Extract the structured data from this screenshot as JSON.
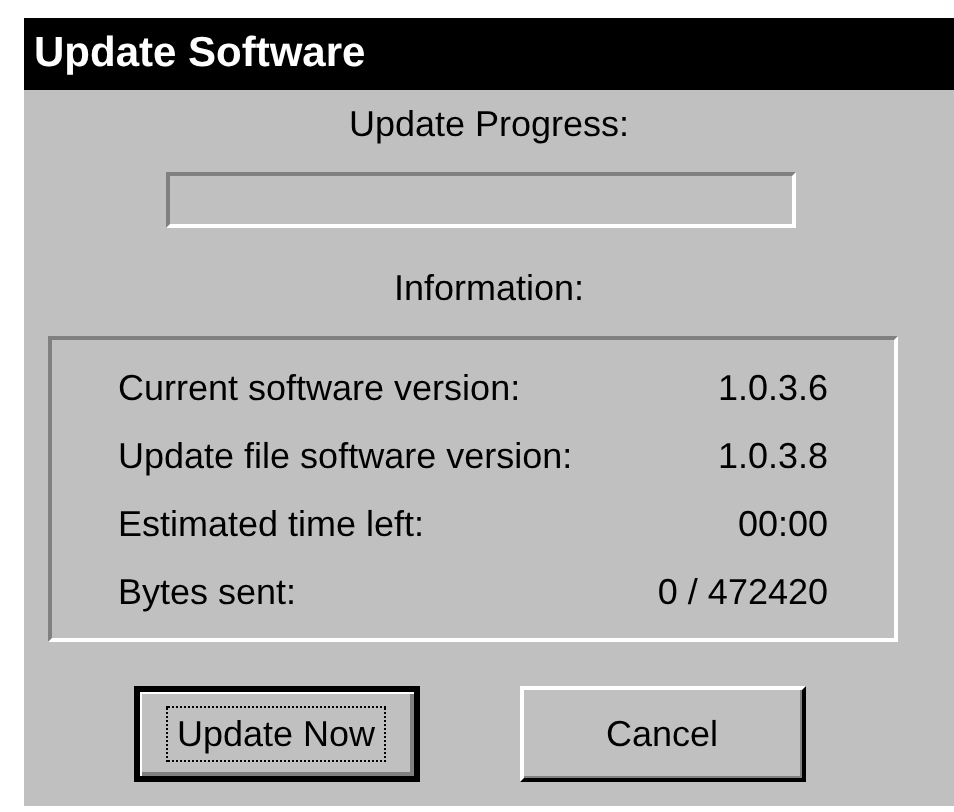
{
  "window": {
    "title": "Update Software"
  },
  "progress": {
    "label": "Update Progress:",
    "level": 0
  },
  "information": {
    "label": "Information:",
    "rows": [
      {
        "label": "Current software version:",
        "value": "1.0.3.6"
      },
      {
        "label": "Update file software version:",
        "value": "1.0.3.8"
      },
      {
        "label": "Estimated time left:",
        "value": "00:00"
      },
      {
        "label": "Bytes sent:",
        "value": "0 / 472420"
      }
    ]
  },
  "buttons": [
    {
      "label": "Update Now",
      "focused": true
    },
    {
      "label": "Cancel",
      "focused": false
    }
  ]
}
